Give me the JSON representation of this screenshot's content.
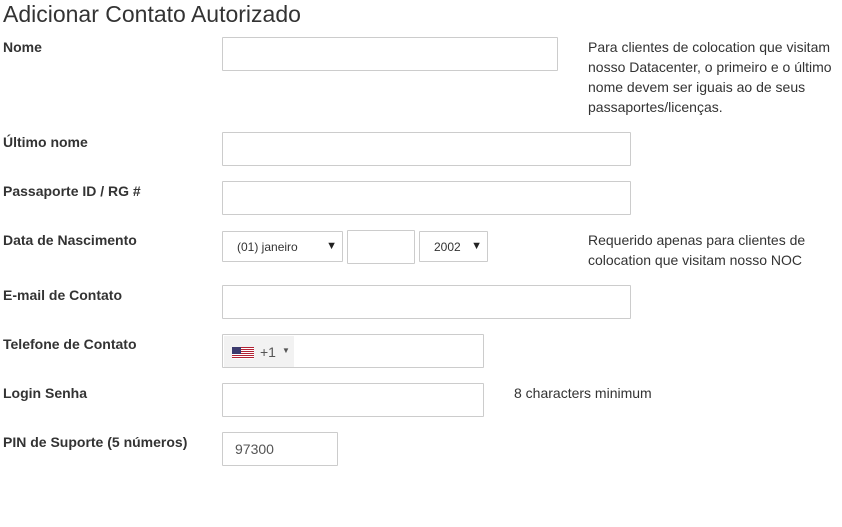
{
  "page_title": "Adicionar Contato Autorizado",
  "fields": {
    "first_name": {
      "label": "Nome",
      "value": "",
      "help": "Para clientes de colocation que visitam nosso Datacenter, o primeiro e o último nome devem ser iguais ao de seus passaportes/licenças."
    },
    "last_name": {
      "label": "Último nome",
      "value": ""
    },
    "passport": {
      "label": "Passaporte ID / RG #",
      "value": ""
    },
    "birth_date": {
      "label": "Data de Nascimento",
      "month": "(01) janeiro",
      "day": "",
      "year": "2002",
      "help": "Requerido apenas para clientes de colocation que visitam nosso NOC"
    },
    "email": {
      "label": "E-mail de Contato",
      "value": ""
    },
    "phone": {
      "label": "Telefone de Contato",
      "dial_code": "+1",
      "flag": "us-flag-icon",
      "value": ""
    },
    "password": {
      "label": "Login Senha",
      "value": "",
      "help": "8 characters minimum"
    },
    "support_pin": {
      "label": "PIN de Suporte (5 números)",
      "value": "97300"
    }
  }
}
